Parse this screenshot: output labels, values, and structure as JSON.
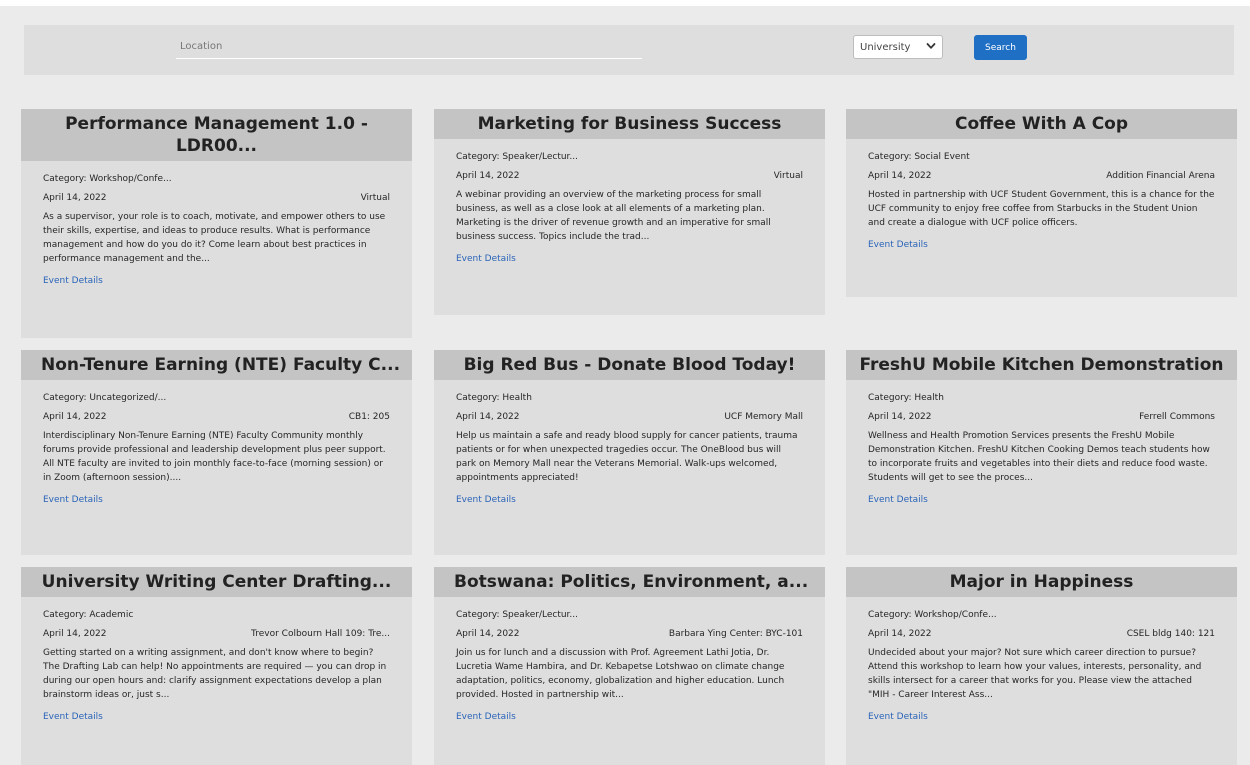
{
  "search": {
    "location_placeholder": "Location",
    "location_value": "",
    "filter_selected": "University",
    "search_label": "Search"
  },
  "colors": {
    "search_button": "#1f6fc5",
    "link": "#2a64b8",
    "card_header": "#c4c4c4",
    "card_body": "#dedede"
  },
  "events": [
    {
      "title": "Performance Management 1.0 - LDR00...",
      "category": "Category: Workshop/Confe...",
      "date": "April 14, 2022",
      "location": "Virtual",
      "description": "As a supervisor, your role is to coach, motivate, and empower others to use their skills, expertise, and ideas to produce results. What is performance management and how do you do it? Come learn about best practices in performance management and the...",
      "link": "Event Details"
    },
    {
      "title": "Marketing for Business Success",
      "category": "Category: Speaker/Lectur...",
      "date": "April 14, 2022",
      "location": "Virtual",
      "description": "A webinar providing an overview of the marketing process for small business, as well as a close look at all elements of a marketing plan. Marketing is the driver of revenue growth and an imperative for small business success. Topics include the trad...",
      "link": "Event Details"
    },
    {
      "title": "Coffee With A Cop",
      "category": "Category: Social Event",
      "date": "April 14, 2022",
      "location": "Addition Financial Arena",
      "description": "Hosted in partnership with UCF Student Government, this is a chance for the UCF community to enjoy free coffee from Starbucks in the Student Union and create a dialogue with UCF police officers.",
      "link": "Event Details"
    },
    {
      "title": "Non-Tenure Earning (NTE) Faculty C...",
      "category": "Category: Uncategorized/...",
      "date": "April 14, 2022",
      "location": "CB1: 205",
      "description": "Interdisciplinary Non-Tenure Earning (NTE) Faculty Community monthly forums provide professional and leadership development plus peer support. All NTE faculty are invited to join monthly face-to-face (morning session) or in Zoom (afternoon session)....",
      "link": "Event Details"
    },
    {
      "title": "Big Red Bus - Donate Blood Today!",
      "category": "Category: Health",
      "date": "April 14, 2022",
      "location": "UCF Memory Mall",
      "description": "Help us maintain a safe and ready blood supply for cancer patients, trauma patients or for when unexpected tragedies occur. The OneBlood bus will park on Memory Mall near the Veterans Memorial. Walk-ups welcomed, appointments appreciated!",
      "link": "Event Details"
    },
    {
      "title": "FreshU Mobile Kitchen Demonstration",
      "category": "Category: Health",
      "date": "April 14, 2022",
      "location": "Ferrell Commons",
      "description": "Wellness and Health Promotion Services presents the FreshU Mobile Demonstration Kitchen. FreshU Kitchen Cooking Demos teach students how to incorporate fruits and vegetables into their diets and reduce food waste. Students will get to see the proces...",
      "link": "Event Details"
    },
    {
      "title": "University Writing Center Drafting...",
      "category": "Category: Academic",
      "date": "April 14, 2022",
      "location": "Trevor Colbourn Hall 109: Tre...",
      "description": "Getting started on a writing assignment, and don't know where to begin? The Drafting Lab can help! No appointments are required — you can drop in during our open hours and: clarify assignment expectations develop a plan brainstorm ideas or, just s...",
      "link": "Event Details"
    },
    {
      "title": "Botswana: Politics, Environment, a...",
      "category": "Category: Speaker/Lectur...",
      "date": "April 14, 2022",
      "location": "Barbara Ying Center: BYC-101",
      "description": "Join us for lunch and a discussion with Prof. Agreement Lathi Jotia, Dr. Lucretia Wame Hambira, and Dr. Kebapetse Lotshwao on climate change adaptation, politics, economy, globalization and higher education. Lunch provided. Hosted in partnership wit...",
      "link": "Event Details"
    },
    {
      "title": "Major in Happiness",
      "category": "Category: Workshop/Confe...",
      "date": "April 14, 2022",
      "location": "CSEL bldg 140: 121",
      "description": "Undecided about your major? Not sure which career direction to pursue? Attend this workshop to learn how your values, interests, personality, and skills intersect for a career that works for you. Please view the attached \"MIH - Career Interest Ass...",
      "link": "Event Details"
    }
  ]
}
